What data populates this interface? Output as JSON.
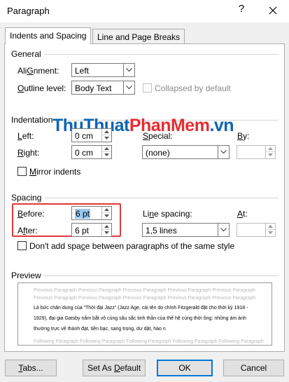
{
  "window": {
    "title": "Paragraph",
    "help_glyph": "?",
    "close_glyph": "✕"
  },
  "tabs": [
    {
      "label": "Indents and Spacing",
      "active": true
    },
    {
      "label": "Line and Page Breaks",
      "active": false
    }
  ],
  "general": {
    "heading": "General",
    "alignment": {
      "label_u": "G",
      "label_rest": "",
      "label_pre": "Ali",
      "label_post": "nment:",
      "value": "Left"
    },
    "outline": {
      "label_pre": "",
      "label_u": "O",
      "label_post": "utline level:",
      "value": "Body Text"
    },
    "collapsed_label": "Collapsed by default"
  },
  "indentation": {
    "heading": "Indentation",
    "left": {
      "label_u": "L",
      "label_post": "eft:",
      "value": "0 cm"
    },
    "right": {
      "label_u": "R",
      "label_post": "ight:",
      "value": "0 cm"
    },
    "special": {
      "label_u": "S",
      "label_post": "pecial:",
      "value": "(none)"
    },
    "by": {
      "label_u": "B",
      "label_post": "y:",
      "value": ""
    },
    "mirror": {
      "label_u": "M",
      "label_post": "irror indents"
    }
  },
  "spacing": {
    "heading": "Spacing",
    "before": {
      "label_u": "B",
      "label_post": "efore:",
      "value": "6 pt"
    },
    "after": {
      "label_pre": "A",
      "label_u": "f",
      "label_post": "ter:",
      "value": "6 pt"
    },
    "line_spacing": {
      "label_pre": "Li",
      "label_u": "n",
      "label_post": "e spacing:",
      "value": "1,5 lines"
    },
    "at": {
      "label_u": "A",
      "label_post": "t:",
      "value": ""
    },
    "dont_add": {
      "label_pre": "Don't add spa",
      "label_u": "c",
      "label_post": "e between paragraphs of the same style"
    }
  },
  "preview": {
    "heading": "Preview",
    "prev_para_1": "Previous Paragraph Previous Paragraph Previous Paragraph Previous Paragraph Previous Paragraph",
    "prev_para_2": "Previous Paragraph Previous Paragraph Previous Paragraph Previous Paragraph Previous Paragraph",
    "sample_1": "Là bức chân dung của “Thời đại Jazz” (Jazz Age, cái tên do chính Fitzgerald đặt cho thời kỳ 1918 -",
    "sample_2": "1929), đại gia Gatsby nắm bắt vô cùng sâu sắc tinh thần của thế hệ cùng thời ông: những ám ảnh",
    "sample_3": "thường trực về thành đạt, tiền bạc, sang trọng, dư dật, hào n",
    "next_para": "Following Paragraph Following Paragraph Following Paragraph Following Paragraph Following Paragraph"
  },
  "buttons": {
    "tabs": {
      "label_u": "T",
      "label_post": "abs..."
    },
    "set_default": {
      "label_pre": "Set As ",
      "label_u": "D",
      "label_post": "efault"
    },
    "ok": "OK",
    "cancel": "Cancel"
  },
  "watermark": {
    "part1": "ThuThuat",
    "part2": "PhanMem",
    "part3": ".vn"
  },
  "colors": {
    "highlight": "#e0393b",
    "default_button": "#0078d7",
    "selection": "#99c9ef"
  }
}
